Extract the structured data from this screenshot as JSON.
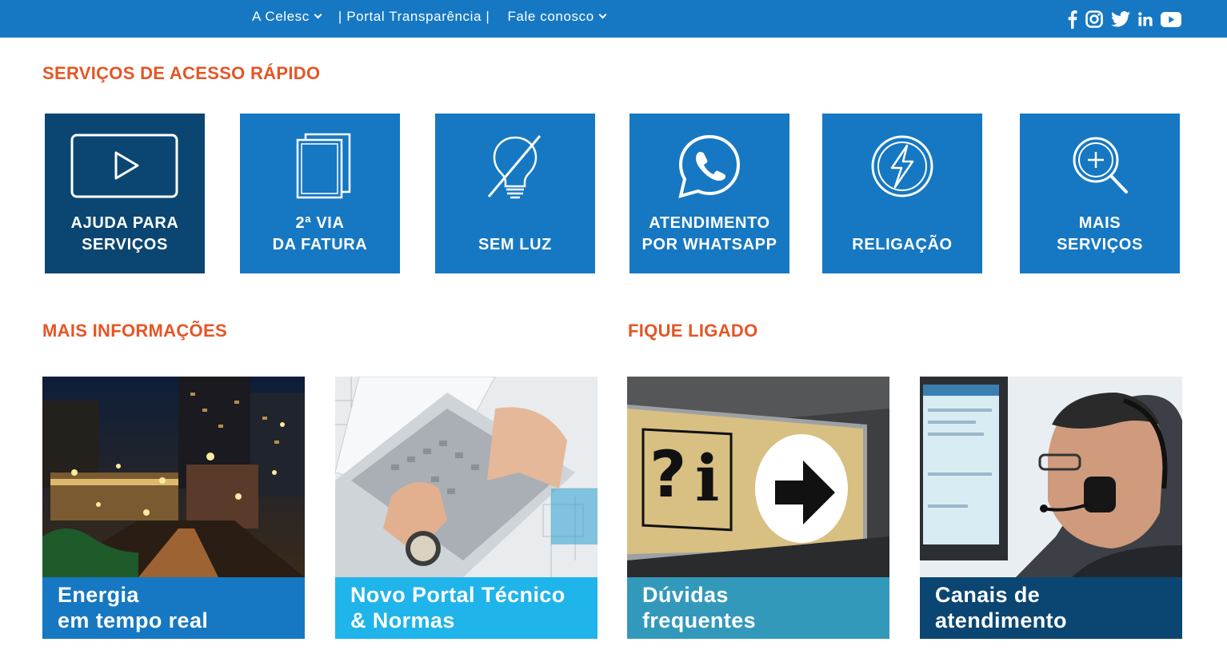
{
  "topbar": {
    "nav": [
      {
        "label": "A Celesc",
        "dropdown": true
      },
      {
        "label": "| Portal Transparência |",
        "dropdown": false
      },
      {
        "label": "Fale conosco",
        "dropdown": true
      }
    ],
    "social": [
      "facebook-icon",
      "instagram-icon",
      "twitter-icon",
      "linkedin-icon",
      "youtube-icon"
    ]
  },
  "quick_services": {
    "title": "SERVIÇOS DE ACESSO RÁPIDO",
    "tiles": [
      {
        "label": "AJUDA PARA\nSERVIÇOS",
        "icon": "video-play-icon"
      },
      {
        "label": "2ª VIA\nDA FATURA",
        "icon": "documents-icon"
      },
      {
        "label": "SEM LUZ",
        "icon": "lightbulb-off-icon"
      },
      {
        "label": "ATENDIMENTO\nPOR WHATSAPP",
        "icon": "whatsapp-icon"
      },
      {
        "label": "RELIGAÇÃO",
        "icon": "power-reconnect-icon"
      },
      {
        "label": "MAIS\nSERVIÇOS",
        "icon": "magnifier-plus-icon"
      }
    ]
  },
  "more_info": {
    "title": "MAIS INFORMAÇÕES",
    "cards": [
      {
        "caption": "Energia\nem tempo real",
        "color": "#1678c2"
      },
      {
        "caption": "Novo Portal Técnico\n& Normas",
        "color": "#1fb4ea"
      }
    ]
  },
  "stay_tuned": {
    "title": "FIQUE LIGADO",
    "cards": [
      {
        "caption": "Dúvidas\nfrequentes",
        "color": "#3399bb"
      },
      {
        "caption": "Canais de\natendimento",
        "color": "#0b4672"
      }
    ]
  },
  "colors": {
    "brand_blue": "#1678c2",
    "dark_blue": "#0b4672",
    "accent_orange": "#e55526"
  }
}
